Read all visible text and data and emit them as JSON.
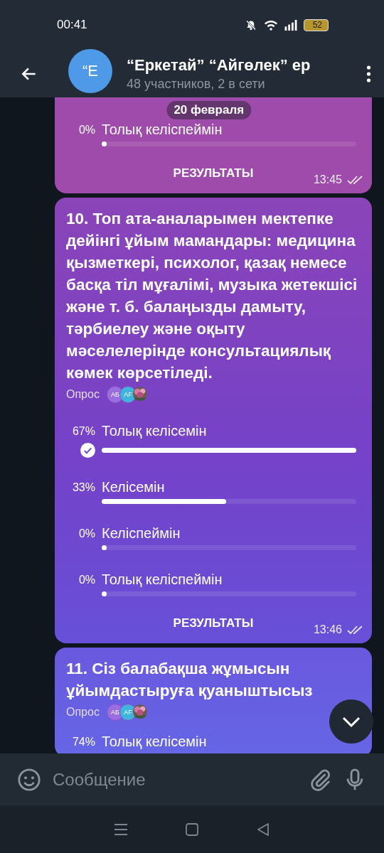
{
  "status_bar": {
    "time": "00:41",
    "battery": "52"
  },
  "header": {
    "avatar": "“E",
    "title": "“Еркетай” “Айгөлек” ер",
    "subtitle": "48 участников, 2 в сети"
  },
  "date_pill": "20 февраля",
  "messages": [
    {
      "kind": "tail",
      "options": [
        {
          "percent": "0%",
          "label": "Толық келіспеймін",
          "level": 0,
          "chosen": false
        }
      ],
      "results_button": "РЕЗУЛЬТАТЫ",
      "time": "13:45",
      "read": true
    },
    {
      "kind": "poll",
      "question": "10. Топ ата-аналарымен мектепке дейінгі ұйым мамандары: медицина қызметкері, психолог, қазақ немесе басқа тіл мұғалімі, музыка жетекшісі және т. б. балаңызды дамыту, тәрбиелеу және оқыту мәселелерінде консультациялық көмек көрсетіледі.",
      "poll_label": "Опрос",
      "voters": [
        {
          "kind": "initials",
          "text": "АБ",
          "color": "#9a6ee0"
        },
        {
          "kind": "initials",
          "text": "AF",
          "color": "#3fb4dc"
        },
        {
          "kind": "picture"
        }
      ],
      "options": [
        {
          "percent": "67%",
          "label": "Толық келісемін",
          "level": 1,
          "chosen": true
        },
        {
          "percent": "33%",
          "label": "Келісемін",
          "level": 0.49,
          "chosen": false
        },
        {
          "percent": "0%",
          "label": "Келіспеймін",
          "level": 0,
          "chosen": false
        },
        {
          "percent": "0%",
          "label": "Толық келіспеймін",
          "level": 0,
          "chosen": false
        }
      ],
      "results_button": "РЕЗУЛЬТАТЫ",
      "time": "13:46",
      "read": true
    },
    {
      "kind": "poll",
      "question": "11. Сіз балабақша жұмысын ұйымдастыруға қуаныштысыз",
      "poll_label": "Опрос",
      "voters": [
        {
          "kind": "initials",
          "text": "АБ",
          "color": "#9a6ee0"
        },
        {
          "kind": "initials",
          "text": "AF",
          "color": "#3fb4dc"
        },
        {
          "kind": "picture"
        }
      ],
      "options": [
        {
          "percent": "74%",
          "label": "Толық келісемін",
          "chosen": false
        }
      ]
    }
  ],
  "composer": {
    "placeholder": "Сообщение"
  }
}
